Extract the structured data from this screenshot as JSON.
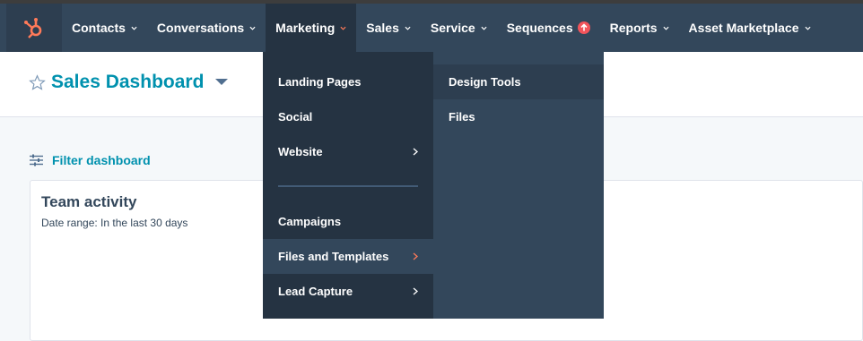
{
  "nav": {
    "items": [
      {
        "label": "Contacts"
      },
      {
        "label": "Conversations"
      },
      {
        "label": "Marketing"
      },
      {
        "label": "Sales"
      },
      {
        "label": "Service"
      },
      {
        "label": "Sequences"
      },
      {
        "label": "Reports"
      },
      {
        "label": "Asset Marketplace"
      }
    ],
    "active": "Marketing"
  },
  "header": {
    "title": "Sales Dashboard"
  },
  "filter": {
    "label": "Filter dashboard"
  },
  "card": {
    "title": "Team activity",
    "subtitle": "Date range: In the last 30 days"
  },
  "marketing_menu": {
    "items": [
      {
        "label": "Landing Pages"
      },
      {
        "label": "Social"
      },
      {
        "label": "Website"
      },
      {
        "label": "Campaigns"
      },
      {
        "label": "Files and Templates"
      },
      {
        "label": "Lead Capture"
      }
    ],
    "highlighted": "Files and Templates"
  },
  "submenu": {
    "items": [
      {
        "label": "Design Tools"
      },
      {
        "label": "Files"
      }
    ],
    "highlighted": "Design Tools"
  },
  "colors": {
    "nav_bg": "#33475b",
    "nav_active": "#253342",
    "brand_orange": "#ff7a59",
    "link_teal": "#0091ae",
    "badge_red": "#f2545b"
  },
  "icons": {
    "logo": "hubspot-sprocket-icon",
    "star": "star-icon",
    "filter": "filter-sliders-icon",
    "badge": "upgrade-arrow-icon",
    "chevron": "chevron-down-icon",
    "submenu_arrow": "chevron-right-icon"
  }
}
